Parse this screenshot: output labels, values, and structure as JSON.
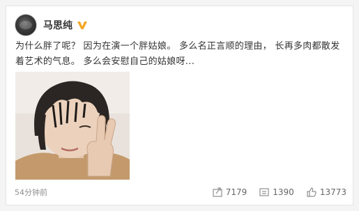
{
  "post": {
    "author": "马思纯",
    "verified_icon": "vip-v-icon",
    "text": "为什么胖了呢？  因为在演一个胖姑娘。  多么名正言顺的理由，  长再多肉都散发着艺术的气息。  多么会安慰自己的姑娘呀...",
    "time": "54分钟前",
    "image_icon": "selfie-photo"
  },
  "actions": {
    "repost": {
      "icon": "repost-icon",
      "count": "7179"
    },
    "comment": {
      "icon": "comment-icon",
      "count": "1390"
    },
    "like": {
      "icon": "thumb-up-icon",
      "count": "13773"
    }
  },
  "colors": {
    "accent_badge": "#f5a623",
    "text": "#333333",
    "muted": "#8f8f8f"
  }
}
